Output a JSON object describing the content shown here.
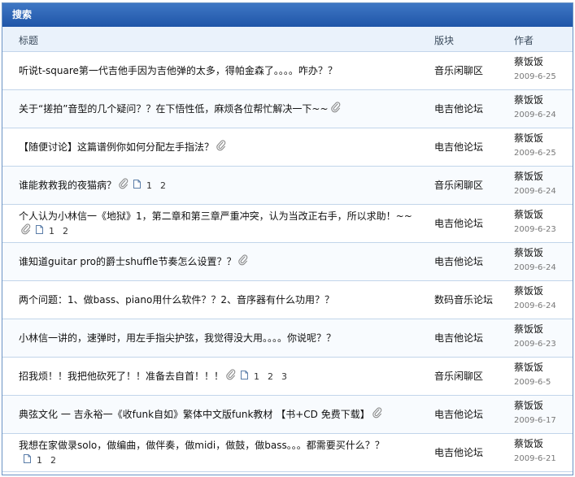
{
  "panel": {
    "title": "搜索"
  },
  "columns": {
    "subject": "标题",
    "forum": "版块",
    "author": "作者"
  },
  "rows": [
    {
      "title": "听说t-square第一代吉他手因为吉他弹的太多，得帕金森了。。。。咋办？？",
      "attach": false,
      "pages": [],
      "forum": "音乐闲聊区",
      "author": "蔡饭饭",
      "date": "2009-6-25"
    },
    {
      "title": "关于“搓拍”音型的几个疑问？？在下悟性低，麻烦各位帮忙解决一下~~",
      "attach": true,
      "pages": [],
      "forum": "电吉他论坛",
      "author": "蔡饭饭",
      "date": "2009-6-24"
    },
    {
      "title": "【随便讨论】这篇谱例你如何分配左手指法？",
      "attach": true,
      "pages": [],
      "forum": "电吉他论坛",
      "author": "蔡饭饭",
      "date": "2009-6-25"
    },
    {
      "title": "谁能救救我的夜猫病？",
      "attach": true,
      "pages": [
        "1",
        "2"
      ],
      "forum": "音乐闲聊区",
      "author": "蔡饭饭",
      "date": "2009-6-24"
    },
    {
      "title": "个人认为小林信一《地狱》1，第二章和第三章严重冲突，认为当改正右手，所以求助！~~",
      "attach": true,
      "pages": [
        "1",
        "2"
      ],
      "forum": "电吉他论坛",
      "author": "蔡饭饭",
      "date": "2009-6-23"
    },
    {
      "title": "谁知道guitar pro的爵士shuffle节奏怎么设置？？",
      "attach": true,
      "pages": [],
      "forum": "电吉他论坛",
      "author": "蔡饭饭",
      "date": "2009-6-24"
    },
    {
      "title": "两个问题：1、做bass、piano用什么软件？？2、音序器有什么功用？？",
      "attach": false,
      "pages": [],
      "forum": "数码音乐论坛",
      "author": "蔡饭饭",
      "date": "2009-6-24"
    },
    {
      "title": "小林信一讲的，速弹时，用左手指尖护弦，我觉得没大用。。。。你说呢？？",
      "attach": false,
      "pages": [],
      "forum": "电吉他论坛",
      "author": "蔡饭饭",
      "date": "2009-6-23"
    },
    {
      "title": "招我烦！！我把他砍死了！！准备去自首！！！",
      "attach": true,
      "pages": [
        "1",
        "2",
        "3"
      ],
      "forum": "音乐闲聊区",
      "author": "蔡饭饭",
      "date": "2009-6-5"
    },
    {
      "title": "典弦文化 一 吉永裕一《收funk自如》繁体中文版funk教材 【书+CD 免费下载】",
      "attach": true,
      "pages": [],
      "forum": "电吉他论坛",
      "author": "蔡饭饭",
      "date": "2009-6-17"
    },
    {
      "title": "我想在家做录solo，做编曲，做伴奏，做midi，做鼓，做bass。。。都需要买什么？？",
      "attach": false,
      "pages": [
        "1",
        "2"
      ],
      "forum": "电吉他论坛",
      "author": "蔡饭饭",
      "date": "2009-6-21"
    }
  ]
}
